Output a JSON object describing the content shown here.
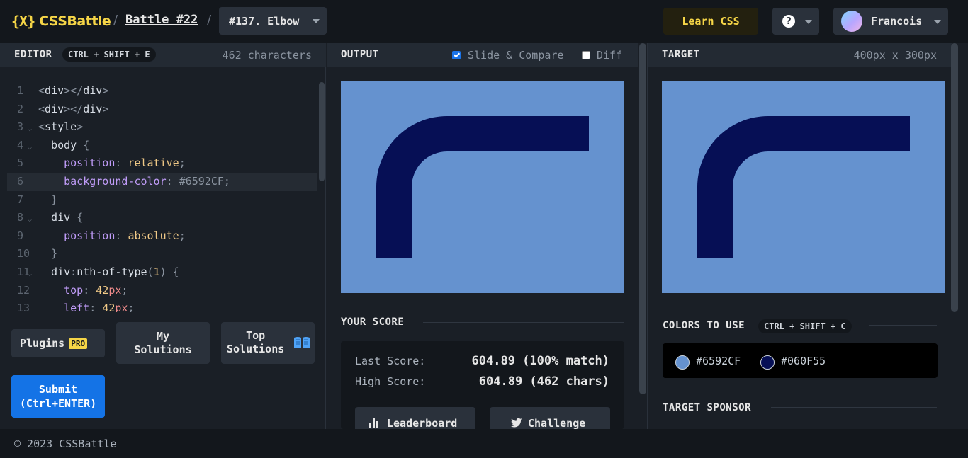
{
  "header": {
    "logo_mark": "{X}",
    "logo_text": "CSSBattle",
    "separator": "/",
    "battle_label": "Battle #22",
    "target_label": "#137. Elbow",
    "learn_label": "Learn CSS",
    "help_glyph": "?",
    "user_name": "Francois"
  },
  "editor": {
    "title": "EDITOR",
    "shortcut": "CTRL + SHIFT + E",
    "char_count": "462 characters",
    "lines": [
      {
        "n": "1",
        "fold": false,
        "tokens": [
          [
            "t-punc",
            "<"
          ],
          [
            "t-tag",
            "div"
          ],
          [
            "t-punc",
            "></"
          ],
          [
            "t-tag",
            "div"
          ],
          [
            "t-punc",
            ">"
          ]
        ]
      },
      {
        "n": "2",
        "fold": false,
        "tokens": [
          [
            "t-punc",
            "<"
          ],
          [
            "t-tag",
            "div"
          ],
          [
            "t-punc",
            "></"
          ],
          [
            "t-tag",
            "div"
          ],
          [
            "t-punc",
            ">"
          ]
        ]
      },
      {
        "n": "3",
        "fold": true,
        "tokens": [
          [
            "t-punc",
            "<"
          ],
          [
            "t-tag",
            "style"
          ],
          [
            "t-punc",
            ">"
          ]
        ]
      },
      {
        "n": "4",
        "fold": true,
        "tokens": [
          [
            "t-tag",
            "  body "
          ],
          [
            "t-punc",
            "{"
          ]
        ]
      },
      {
        "n": "5",
        "fold": false,
        "tokens": [
          [
            "t-prop",
            "    position"
          ],
          [
            "t-punc",
            ": "
          ],
          [
            "t-val",
            "relative"
          ],
          [
            "t-punc",
            ";"
          ]
        ]
      },
      {
        "n": "6",
        "fold": false,
        "active": true,
        "tokens": [
          [
            "t-prop",
            "    background-color"
          ],
          [
            "t-punc",
            ": "
          ],
          [
            "t-hex",
            "#6592CF"
          ],
          [
            "t-punc",
            ";"
          ]
        ]
      },
      {
        "n": "7",
        "fold": false,
        "tokens": [
          [
            "t-punc",
            "  }"
          ]
        ]
      },
      {
        "n": "8",
        "fold": true,
        "tokens": [
          [
            "t-tag",
            "  div "
          ],
          [
            "t-punc",
            "{"
          ]
        ]
      },
      {
        "n": "9",
        "fold": false,
        "tokens": [
          [
            "t-prop",
            "    position"
          ],
          [
            "t-punc",
            ": "
          ],
          [
            "t-val",
            "absolute"
          ],
          [
            "t-punc",
            ";"
          ]
        ]
      },
      {
        "n": "10",
        "fold": false,
        "tokens": [
          [
            "t-punc",
            "  }"
          ]
        ]
      },
      {
        "n": "11",
        "fold": true,
        "tokens": [
          [
            "t-tag",
            "  div"
          ],
          [
            "t-punc",
            ":"
          ],
          [
            "t-tag",
            "nth-of-type"
          ],
          [
            "t-punc",
            "("
          ],
          [
            "t-num",
            "1"
          ],
          [
            "t-punc",
            ") {"
          ]
        ]
      },
      {
        "n": "12",
        "fold": false,
        "tokens": [
          [
            "t-prop",
            "    top"
          ],
          [
            "t-punc",
            ": "
          ],
          [
            "t-num",
            "42"
          ],
          [
            "t-unit",
            "px"
          ],
          [
            "t-punc",
            ";"
          ]
        ]
      },
      {
        "n": "13",
        "fold": false,
        "tokens": [
          [
            "t-prop",
            "    left"
          ],
          [
            "t-punc",
            ": "
          ],
          [
            "t-num",
            "42"
          ],
          [
            "t-unit",
            "px"
          ],
          [
            "t-punc",
            ";"
          ]
        ]
      }
    ],
    "plugins_label": "Plugins",
    "pro_badge": "PRO",
    "my_solutions_line1": "My",
    "my_solutions_line2": "Solutions",
    "top_solutions_line1": "Top",
    "top_solutions_line2": "Solutions",
    "submit_line1": "Submit",
    "submit_line2": "(Ctrl+ENTER)"
  },
  "output": {
    "title": "OUTPUT",
    "slide_compare_label": "Slide & Compare",
    "slide_compare_checked": true,
    "diff_label": "Diff",
    "diff_checked": false,
    "score_title": "YOUR SCORE",
    "last_score_label": "Last Score:",
    "last_score_value": "604.89 (100% match)",
    "high_score_label": "High Score:",
    "high_score_value": "604.89 (462 chars)",
    "leaderboard_label": "Leaderboard",
    "challenge_label": "Challenge"
  },
  "target": {
    "title": "TARGET",
    "dimensions": "400px x 300px",
    "colors_title": "COLORS TO USE",
    "colors_shortcut": "CTRL + SHIFT + C",
    "colors": [
      {
        "hex": "#6592CF"
      },
      {
        "hex": "#060F55"
      }
    ],
    "sponsor_title": "TARGET SPONSOR"
  },
  "footer": {
    "copyright": "© 2023 CSSBattle"
  },
  "palette": {
    "accent_yellow": "#f5d547",
    "submit_blue": "#1473e6",
    "bg_color": "#6592CF",
    "shape_color": "#060F55"
  }
}
